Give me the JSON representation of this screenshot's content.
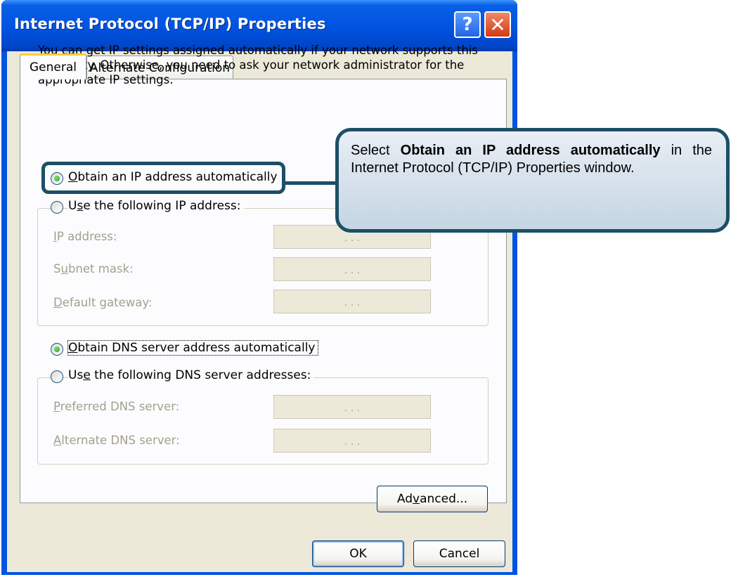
{
  "window": {
    "title": "Internet Protocol (TCP/IP) Properties",
    "help_glyph": "?",
    "close_glyph": "✕"
  },
  "tabs": [
    {
      "label": "General",
      "selected": true
    },
    {
      "label": "Alternate Configuration",
      "selected": false
    }
  ],
  "intro_text": "You can get IP settings assigned automatically if your network supports this capability. Otherwise, you need to ask your network administrator for the appropriate IP settings.",
  "ip": {
    "auto_option": {
      "pre": "",
      "key": "O",
      "post": "btain an IP address automatically",
      "checked": true
    },
    "manual_option": {
      "pre": "U",
      "key": "s",
      "post": "e the following IP address:",
      "checked": false
    },
    "fields": [
      {
        "pre": "",
        "key": "I",
        "post": "P address:",
        "value": ". . ."
      },
      {
        "pre": "S",
        "key": "u",
        "post": "bnet mask:",
        "value": ". . ."
      },
      {
        "pre": "",
        "key": "D",
        "post": "efault gateway:",
        "value": ". . ."
      }
    ]
  },
  "dns": {
    "auto_option": {
      "pre": "",
      "key": "O",
      "post": "btain DNS server address automatically",
      "checked": true
    },
    "manual_option": {
      "pre": "Us",
      "key": "e",
      "post": " the following DNS server addresses:",
      "checked": false
    },
    "fields": [
      {
        "pre": "",
        "key": "P",
        "post": "referred DNS server:",
        "value": ". . ."
      },
      {
        "pre": "",
        "key": "A",
        "post": "lternate DNS server:",
        "value": ". . ."
      }
    ]
  },
  "buttons": {
    "advanced": {
      "pre": "Ad",
      "key": "v",
      "post": "anced..."
    },
    "ok": "OK",
    "cancel": "Cancel"
  },
  "callout": {
    "prefix": "Select ",
    "bold": "Obtain an IP address automatically",
    "suffix": " in the Internet Protocol (TCP/IP) Properties window."
  },
  "colors": {
    "titlebar": "#0054e3",
    "dialog_face": "#ece9d8",
    "callout_border": "#1c4f66",
    "radio_selected": "#21a121"
  }
}
